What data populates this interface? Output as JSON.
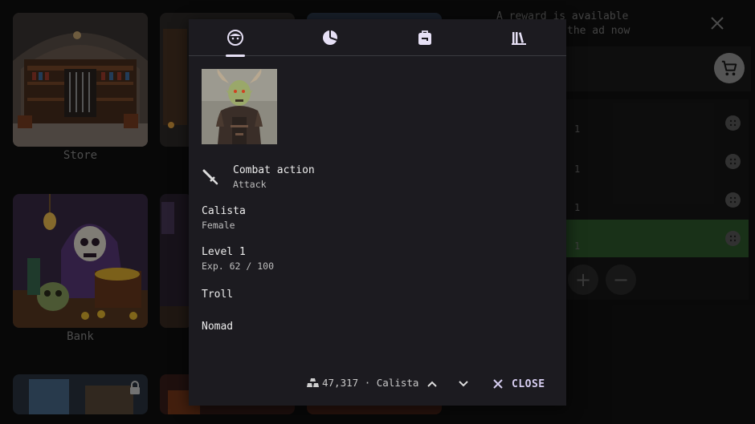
{
  "background": {
    "tiles": [
      {
        "name": "store",
        "label": "Store"
      },
      {
        "name": "bank",
        "label": "Bank"
      }
    ],
    "reward": {
      "line1": "A reward is available",
      "line2": "the ad now"
    },
    "list_rows": [
      {
        "qty": "1",
        "highlighted": false
      },
      {
        "qty": "1",
        "highlighted": false
      },
      {
        "qty": "1",
        "highlighted": false
      },
      {
        "qty": "1",
        "highlighted": true
      }
    ],
    "plus_label": "+",
    "minus_label": "−"
  },
  "dialog": {
    "tabs": [
      {
        "icon": "face-icon",
        "active": true
      },
      {
        "icon": "pie-chart-icon",
        "active": false
      },
      {
        "icon": "backpack-icon",
        "active": false
      },
      {
        "icon": "library-icon",
        "active": false
      }
    ],
    "portrait_alt": "horned troll warrior portrait",
    "combat": {
      "title": "Combat action",
      "value": "Attack"
    },
    "character": {
      "name": "Calista",
      "gender": "Female"
    },
    "level": {
      "title": "Level 1",
      "exp": "Exp. 62 / 100"
    },
    "race": "Troll",
    "class": "Nomad",
    "footer": {
      "gold": "47,317",
      "separator": "·",
      "character_name": "Calista",
      "close_label": "CLOSE"
    }
  },
  "colors": {
    "dialog_bg": "#1c1b20",
    "accent": "#d6cdf0",
    "highlight_row": "#2f5a2c"
  }
}
